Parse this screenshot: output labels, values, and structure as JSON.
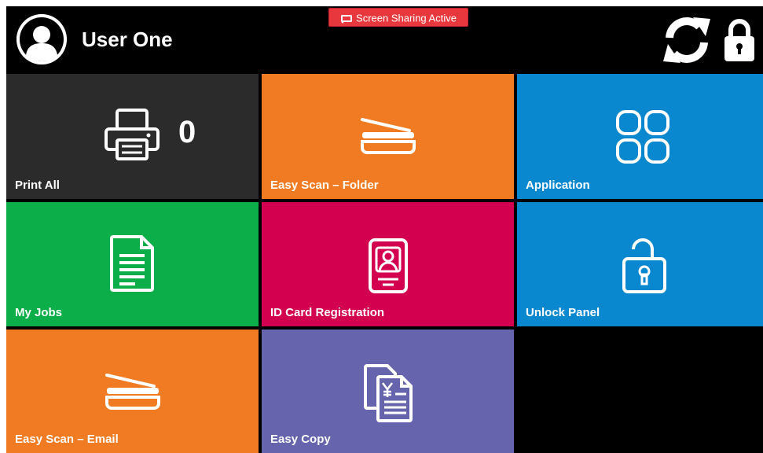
{
  "header": {
    "user_name": "User One",
    "screen_sharing_label": "Screen Sharing Active",
    "refresh_icon": "refresh-icon",
    "lock_icon": "lock-icon",
    "avatar_icon": "user-avatar-icon"
  },
  "tiles": [
    {
      "label": "Print All",
      "icon": "printer-icon",
      "count": "0",
      "color": "#2b2b2b"
    },
    {
      "label": "Easy Scan – Folder",
      "icon": "scanner-icon",
      "color": "#f07b22"
    },
    {
      "label": "Application",
      "icon": "apps-grid-icon",
      "color": "#0a88cf"
    },
    {
      "label": "My Jobs",
      "icon": "document-icon",
      "color": "#0cae4a"
    },
    {
      "label": "ID Card Registration",
      "icon": "id-card-icon",
      "color": "#d2004f"
    },
    {
      "label": "Unlock Panel",
      "icon": "unlock-icon",
      "color": "#0a88cf"
    },
    {
      "label": "Easy Scan – Email",
      "icon": "scanner-icon",
      "color": "#f07b22"
    },
    {
      "label": "Easy Copy",
      "icon": "copy-icon",
      "color": "#6564ac"
    }
  ]
}
